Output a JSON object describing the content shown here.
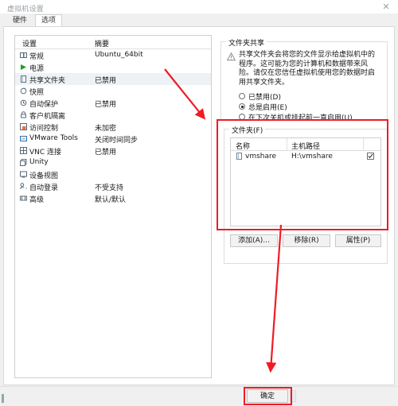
{
  "window": {
    "title": "虚拟机设置",
    "close_label": "✕"
  },
  "tabs": [
    {
      "label": "硬件",
      "active": false
    },
    {
      "label": "选项",
      "active": true
    }
  ],
  "settings_list": {
    "columns": [
      "设置",
      "摘要"
    ],
    "rows": [
      {
        "icon": "general-icon",
        "name": "常规",
        "summary": "Ubuntu_64bit",
        "selected": false
      },
      {
        "icon": "power-icon",
        "name": "电源",
        "summary": "",
        "selected": false
      },
      {
        "icon": "folder-icon",
        "name": "共享文件夹",
        "summary": "已禁用",
        "selected": true
      },
      {
        "icon": "snapshot-icon",
        "name": "快照",
        "summary": "",
        "selected": false
      },
      {
        "icon": "autoprotect-icon",
        "name": "自动保护",
        "summary": "已禁用",
        "selected": false
      },
      {
        "icon": "lock-icon",
        "name": "客户机隔离",
        "summary": "",
        "selected": false
      },
      {
        "icon": "access-icon",
        "name": "访问控制",
        "summary": "未加密",
        "selected": false
      },
      {
        "icon": "vmtools-icon",
        "name": "VMware Tools",
        "summary": "关闭时间同步",
        "selected": false
      },
      {
        "icon": "vnc-icon",
        "name": "VNC 连接",
        "summary": "已禁用",
        "selected": false
      },
      {
        "icon": "unity-icon",
        "name": "Unity",
        "summary": "",
        "selected": false
      },
      {
        "icon": "deviceview-icon",
        "name": "设备视图",
        "summary": "",
        "selected": false
      },
      {
        "icon": "autologon-icon",
        "name": "自动登录",
        "summary": "不受支持",
        "selected": false
      },
      {
        "icon": "advanced-icon",
        "name": "高级",
        "summary": "默认/默认",
        "selected": false
      }
    ]
  },
  "folder_sharing": {
    "legend": "文件夹共享",
    "warning": "共享文件夹会将您的文件显示给虚拟机中的程序。这可能为您的计算机和数据带来风险。请仅在您信任虚拟机使用您的数据时启用共享文件夹。",
    "options": [
      {
        "label": "已禁用(D)",
        "selected": false
      },
      {
        "label": "总是启用(E)",
        "selected": true
      },
      {
        "label": "在下次关机或挂起前一直启用(U)",
        "selected": false
      }
    ]
  },
  "folders": {
    "legend": "文件夹(F)",
    "columns": [
      "名称",
      "主机路径"
    ],
    "rows": [
      {
        "name": "vmshare",
        "host_path": "H:\\vmshare",
        "enabled": true
      }
    ],
    "buttons": {
      "add": "添加(A)...",
      "remove": "移除(R)",
      "properties": "属性(P)"
    }
  },
  "footer": {
    "ok": "确定"
  },
  "annotation": {
    "color": "#ee1c25"
  }
}
